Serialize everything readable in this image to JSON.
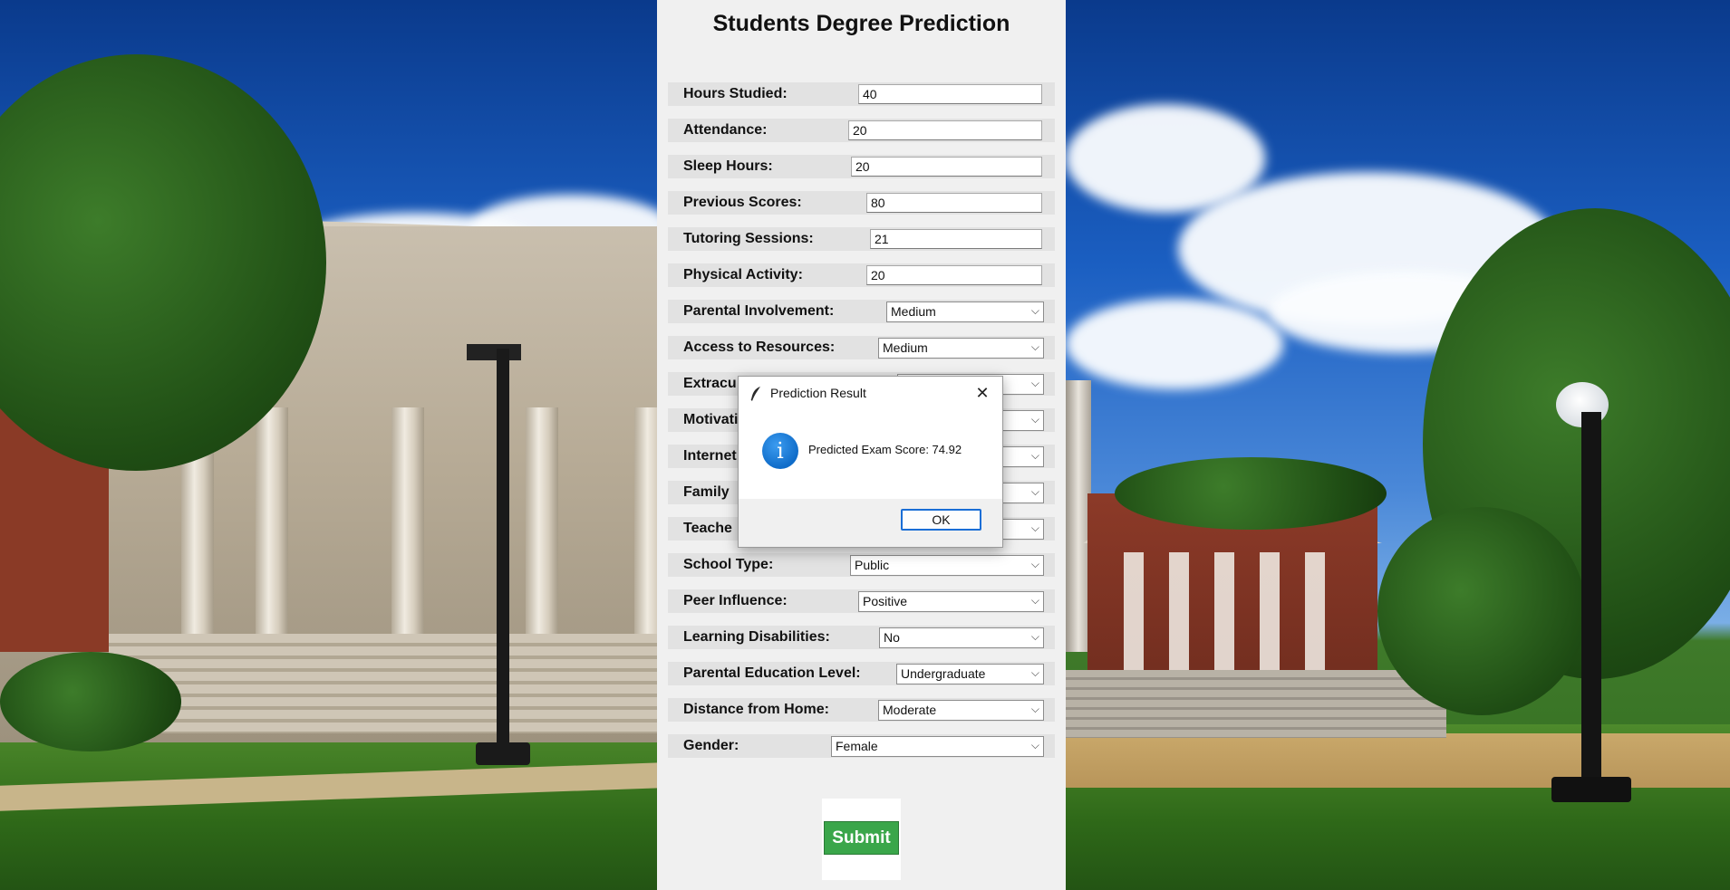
{
  "app": {
    "title": "Students Degree Prediction"
  },
  "form": {
    "fields": [
      {
        "label": "Hours Studied:",
        "value": "40",
        "kind": "entry"
      },
      {
        "label": "Attendance:",
        "value": "20",
        "kind": "entry"
      },
      {
        "label": "Sleep Hours:",
        "value": "20",
        "kind": "entry"
      },
      {
        "label": "Previous Scores:",
        "value": "80",
        "kind": "entry"
      },
      {
        "label": "Tutoring Sessions:",
        "value": "21",
        "kind": "entry"
      },
      {
        "label": "Physical Activity:",
        "value": "20",
        "kind": "entry"
      },
      {
        "label": "Parental Involvement:",
        "value": "Medium",
        "kind": "select"
      },
      {
        "label": "Access to Resources:",
        "value": "Medium",
        "kind": "select"
      },
      {
        "label": "Extracu",
        "value": "",
        "kind": "select"
      },
      {
        "label": "Motivati",
        "value": "",
        "kind": "select"
      },
      {
        "label": "Internet",
        "value": "",
        "kind": "select"
      },
      {
        "label": "Family",
        "value": "",
        "kind": "select"
      },
      {
        "label": "Teache",
        "value": "",
        "kind": "select"
      },
      {
        "label": "School Type:",
        "value": "Public",
        "kind": "select"
      },
      {
        "label": "Peer Influence:",
        "value": "Positive",
        "kind": "select"
      },
      {
        "label": "Learning Disabilities:",
        "value": "No",
        "kind": "select"
      },
      {
        "label": "Parental Education Level:",
        "value": "Undergraduate",
        "kind": "select"
      },
      {
        "label": "Distance from Home:",
        "value": "Moderate",
        "kind": "select"
      },
      {
        "label": "Gender:",
        "value": "Female",
        "kind": "select"
      }
    ],
    "submit_label": "Submit"
  },
  "dialog": {
    "title": "Prediction Result",
    "close_glyph": "✕",
    "info_glyph": "i",
    "message": "Predicted Exam Score: 74.92",
    "ok_label": "OK"
  },
  "colors": {
    "submit": "#3aa64a",
    "info": "#0f6cc9",
    "ok_border": "#1a6ed6"
  },
  "icons": {
    "dialog_app": "feather-icon",
    "dialog_info": "info-icon",
    "dialog_close": "close-icon",
    "select_arrow": "chevron-down-icon"
  }
}
